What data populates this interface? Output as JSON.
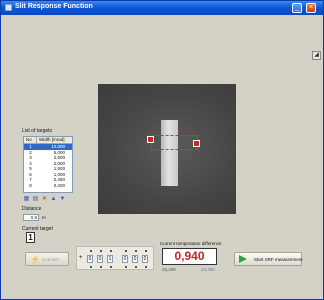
{
  "window": {
    "title": "Slit Response Function",
    "minimize_glyph": "_",
    "close_glyph": "×",
    "icon": "app-icon"
  },
  "targets": {
    "list_label": "List of targets",
    "col_no": "No",
    "col_width": "Width [mrad]",
    "rows": [
      {
        "no": "1",
        "width": "10,000"
      },
      {
        "no": "2",
        "width": "5,000"
      },
      {
        "no": "3",
        "width": "2,500"
      },
      {
        "no": "4",
        "width": "2,000"
      },
      {
        "no": "5",
        "width": "1,500"
      },
      {
        "no": "6",
        "width": "1,000"
      },
      {
        "no": "7",
        "width": "0,250"
      },
      {
        "no": "8",
        "width": "0,200"
      }
    ],
    "selected_index": 0,
    "tool_icons": [
      "save-icon",
      "open-icon",
      "delete-icon",
      "move-up-icon",
      "move-down-icon"
    ]
  },
  "distance": {
    "label": "Distance",
    "value": "0,5",
    "unit": "m"
  },
  "current_target": {
    "label": "Current target",
    "value": "1"
  },
  "connect_button": {
    "label": "Connect"
  },
  "counter": {
    "sign": "+",
    "digits": [
      "0",
      "0",
      "1",
      "0",
      "0",
      "0"
    ]
  },
  "temperature": {
    "label": "Current temperature difference",
    "value": "0,940",
    "left_value": "25,409",
    "right_value": "24,469"
  },
  "sfr_button": {
    "label": "Start SRF measurement"
  },
  "colors": {
    "accent_red": "#c8232c",
    "titlebar_blue": "#0c5ad8",
    "selection_blue": "#316ac5"
  }
}
